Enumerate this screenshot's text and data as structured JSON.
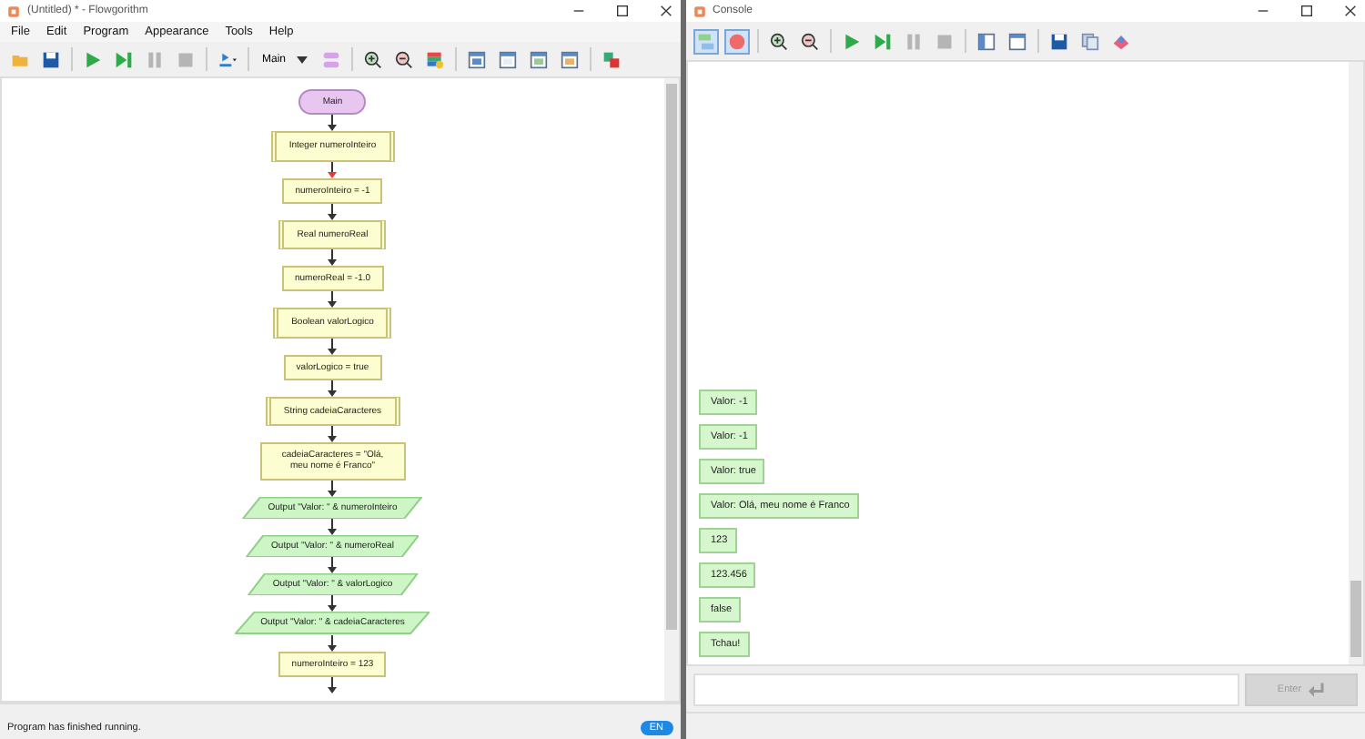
{
  "editor_window": {
    "title": "(Untitled) * - Flowgorithm",
    "menu": [
      "File",
      "Edit",
      "Program",
      "Appearance",
      "Tools",
      "Help"
    ],
    "run_controls": [
      {
        "kind": "run",
        "disabled": false
      },
      {
        "kind": "step",
        "disabled": false
      },
      {
        "kind": "pause",
        "disabled": true
      },
      {
        "kind": "stop",
        "disabled": true
      }
    ],
    "function_select": {
      "value": "Main"
    },
    "flowchart": [
      {
        "kind": "terminal",
        "text": "Main"
      },
      {
        "kind": "declare",
        "text": "Integer numeroInteiro"
      },
      {
        "kind": "assign",
        "text": "numeroInteiro = -1"
      },
      {
        "kind": "declare",
        "text": "Real numeroReal"
      },
      {
        "kind": "assign",
        "text": "numeroReal = -1.0"
      },
      {
        "kind": "declare",
        "text": "Boolean valorLogico"
      },
      {
        "kind": "assign",
        "text": "valorLogico = true"
      },
      {
        "kind": "declare",
        "text": "String cadeiaCaracteres"
      },
      {
        "kind": "assign",
        "text": "cadeiaCaracteres = \"Olá, meu nome é Franco\""
      },
      {
        "kind": "output",
        "text": "Output \"Valor: \" & numeroInteiro"
      },
      {
        "kind": "output",
        "text": "Output \"Valor: \" & numeroReal"
      },
      {
        "kind": "output",
        "text": "Output \"Valor: \" & valorLogico"
      },
      {
        "kind": "output",
        "text": "Output \"Valor: \" & cadeiaCaracteres"
      },
      {
        "kind": "assign",
        "text": "numeroInteiro = 123"
      }
    ],
    "status": "Program has finished running.",
    "language": "EN"
  },
  "console_window": {
    "title": "Console",
    "mode_buttons": [
      {
        "kind": "chat",
        "selected": true
      },
      {
        "kind": "record",
        "selected": true
      }
    ],
    "run_controls": [
      {
        "kind": "run",
        "disabled": false
      },
      {
        "kind": "step",
        "disabled": false
      },
      {
        "kind": "pause",
        "disabled": true
      },
      {
        "kind": "stop",
        "disabled": true
      }
    ],
    "messages": [
      "Valor: -1",
      "Valor: -1",
      "Valor: true",
      "Valor: Olá, meu nome é Franco",
      "123",
      "123.456",
      "false",
      "Tchau!"
    ],
    "enter_button": {
      "label": "Enter",
      "disabled": true
    }
  }
}
